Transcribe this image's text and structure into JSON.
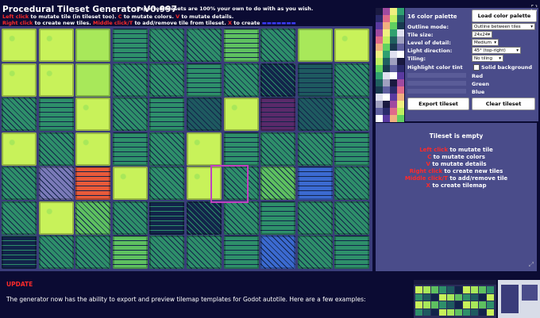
{
  "header": {
    "title": "Procedural Tileset Generator V0.997",
    "exported_note": "Exported tilesets are 100% your own to do with as you wish.",
    "line1_left_click": "Left click",
    "line1_rest": " to mutate tile (in tileset too). ",
    "line1_c": "C",
    "line1_c_rest": " to mutate colors. ",
    "line1_v": "V",
    "line1_v_rest": " to mutate details.",
    "line2_right_click": "Right click",
    "line2_rest1": " to create new tiles. ",
    "line2_middle": "Middle click/T",
    "line2_rest2": " to add/remove tile from tileset. ",
    "line2_x": "X",
    "line2_rest3": " to create "
  },
  "colors": {
    "background": "#0b0b33",
    "grid": "#3a3c7a",
    "panel": "#4a4c8a",
    "accent_red": "#ff2a2a"
  },
  "panel": {
    "palette_label": "16 color palette",
    "load_palette_button": "Load color palette",
    "outline_label": "Outline mode:",
    "outline_value": "Outline between tiles",
    "tile_size_label": "Tile size:",
    "tile_size_value": "24x24",
    "detail_label": "Level of detail:",
    "detail_value": "Medium",
    "light_label": "Light direction:",
    "light_value": "45° (top-right)",
    "tiling_label": "Tiling:",
    "tiling_value": "No tiling",
    "highlight_label": "Highlight color tint",
    "solid_bg_label": "Solid background",
    "tint_red": "Red",
    "tint_green": "Green",
    "tint_blue": "Blue",
    "export_button": "Export tileset",
    "clear_button": "Clear tileset"
  },
  "info": {
    "title": "Tileset is empty",
    "l1_key": "Left click",
    "l1_rest": " to mutate tile",
    "l2_key": "C",
    "l2_rest": " to mutate colors",
    "l3_key": "V",
    "l3_rest": " to mutate details",
    "l4_key": "Right click",
    "l4_rest": " to create new tiles",
    "l5_key": "Middle click/T",
    "l5_rest": " to add/remove tile",
    "l6_key": "X",
    "l6_rest": " to create tilemap"
  },
  "footer": {
    "update_label": "UPDATE",
    "paragraph": "The generator now has the ability to export and preview tilemap templates for Godot autotile. Here are a few examples:"
  },
  "palette_colors": [
    "#1a1a40",
    "#2a2a6a",
    "#5a3aa0",
    "#a04aa0",
    "#e06a8a",
    "#f0b080",
    "#f0f080",
    "#c0f060",
    "#60d060",
    "#30a070",
    "#206060",
    "#1a3a50",
    "#e0e0f0",
    "#a0a0c0",
    "#6060a0",
    "#ffffff"
  ],
  "tile_colors": [
    "#c8f25a",
    "#a8e85a",
    "#5ec060",
    "#2e8f6a",
    "#1e5a60",
    "#12244a",
    "#3b6ad0",
    "#5a2a6a",
    "#e85a3a",
    "#7a7ab8"
  ]
}
